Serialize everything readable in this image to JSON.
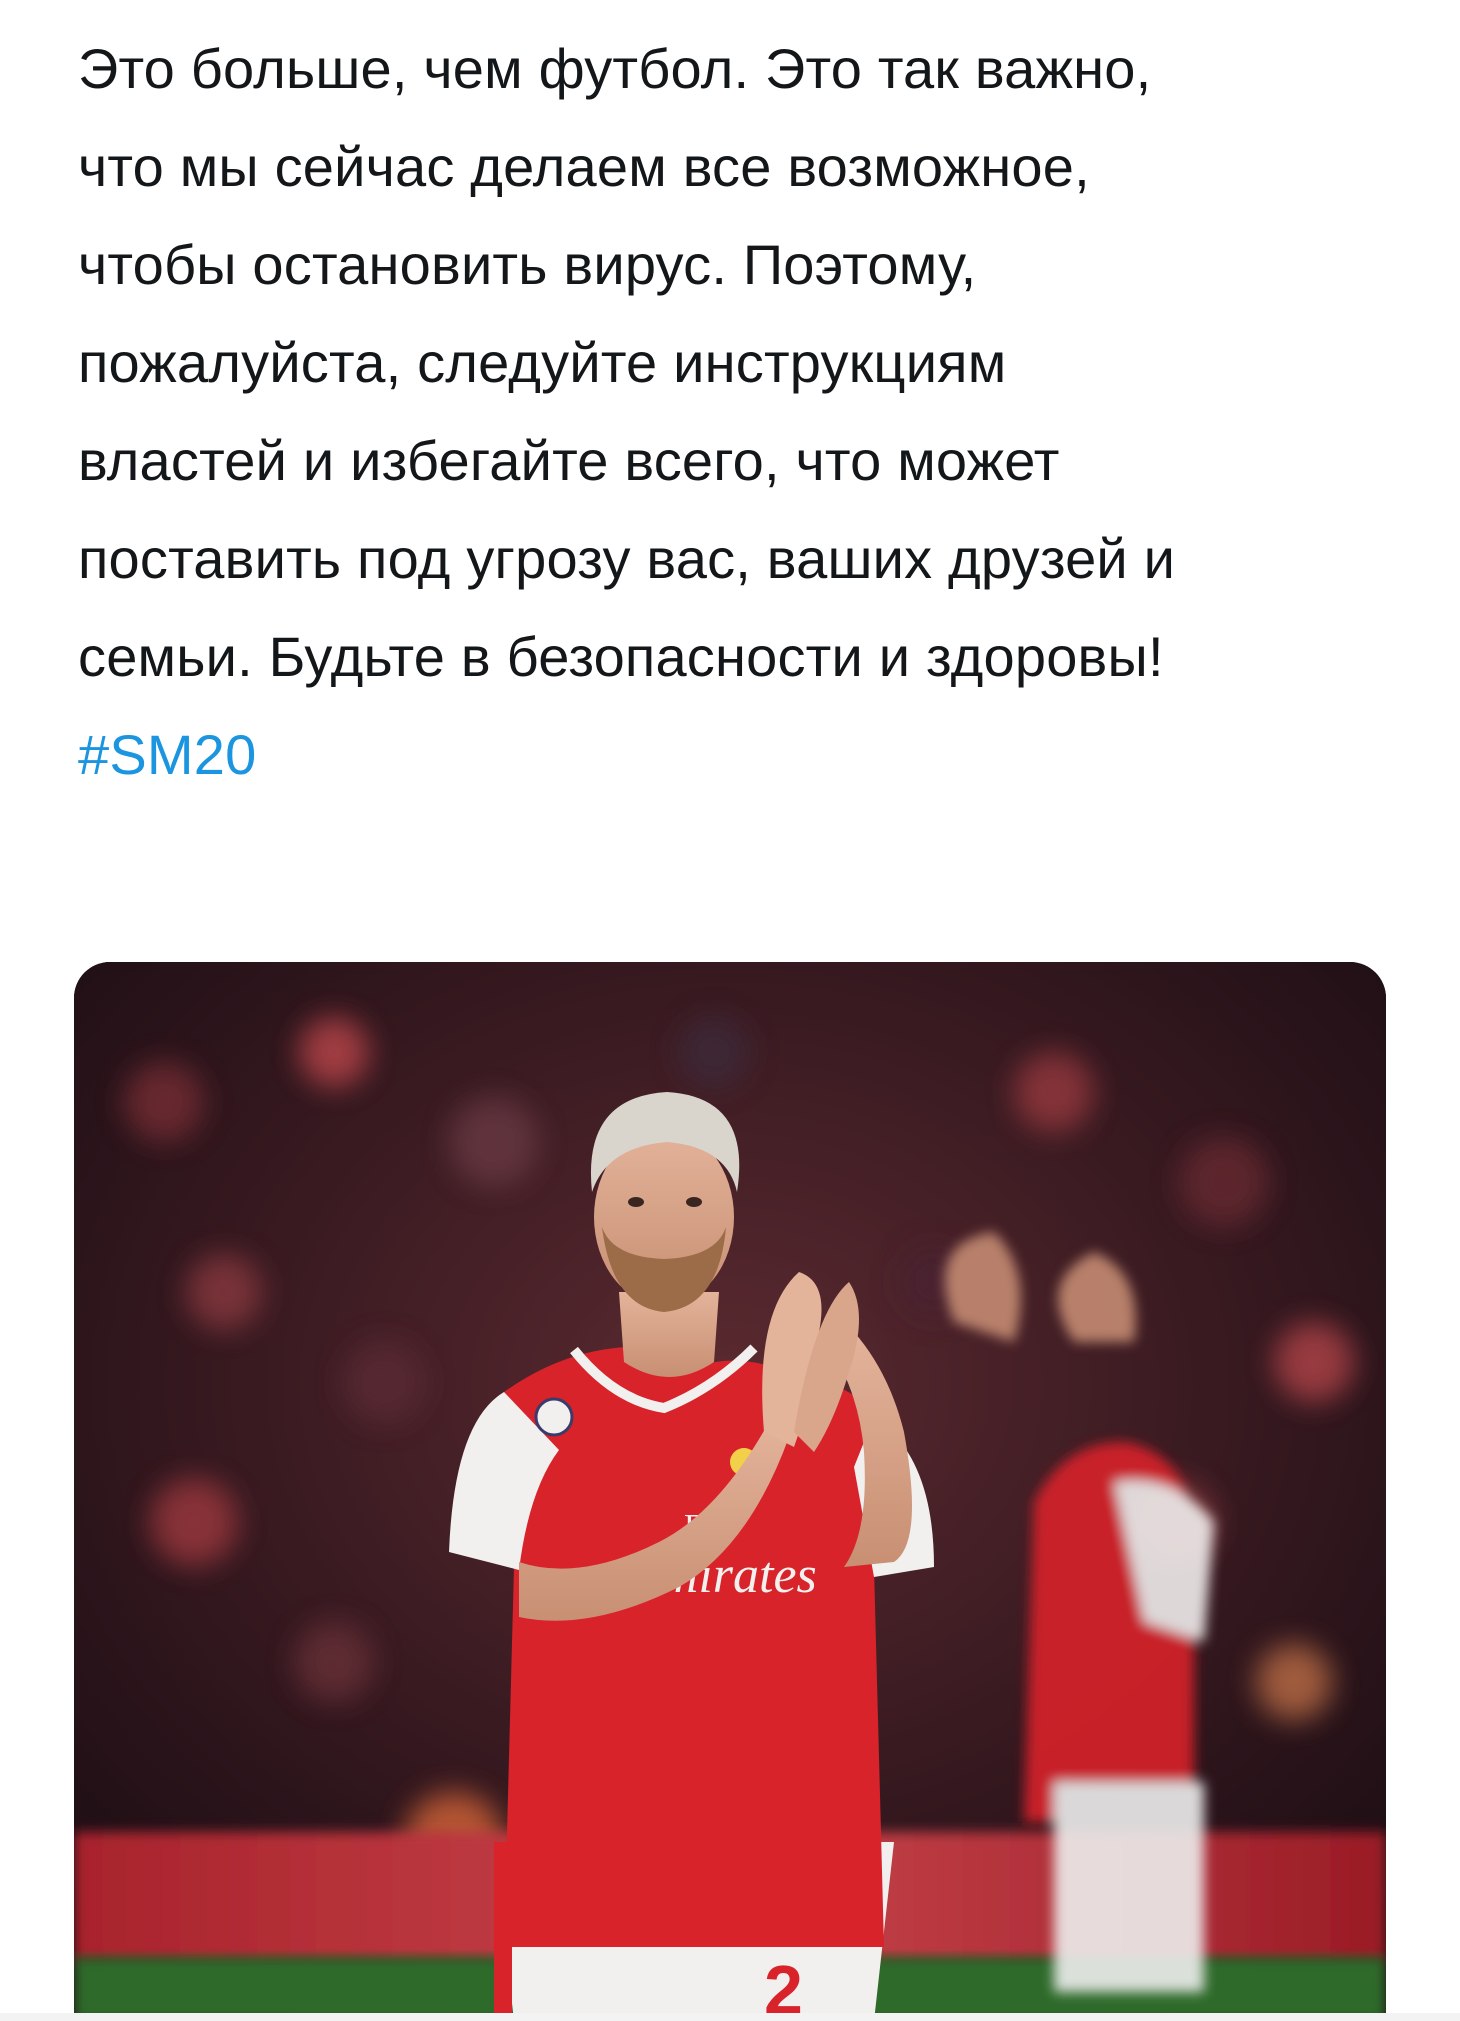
{
  "tweet": {
    "lines": [
      "Это больше, чем футбол. Это так важно,",
      "что мы сейчас делаем все возможное,",
      "чтобы остановить вирус. Поэтому,",
      "пожалуйста, следуйте инструкциям",
      "властей и избегайте всего, что может",
      "поставить под угрозу вас, ваших друзей и",
      "семьи. Будьте в безопасности и здоровы!"
    ],
    "hashtag": "#SM20"
  },
  "photo": {
    "shirt_sponsor_line1": "Fly",
    "shirt_sponsor_line2": "Emirates",
    "shorts_number": "2"
  },
  "colors": {
    "hashtag": "#1b95e0",
    "text": "#14171a",
    "shirt_red": "#d8232a"
  }
}
